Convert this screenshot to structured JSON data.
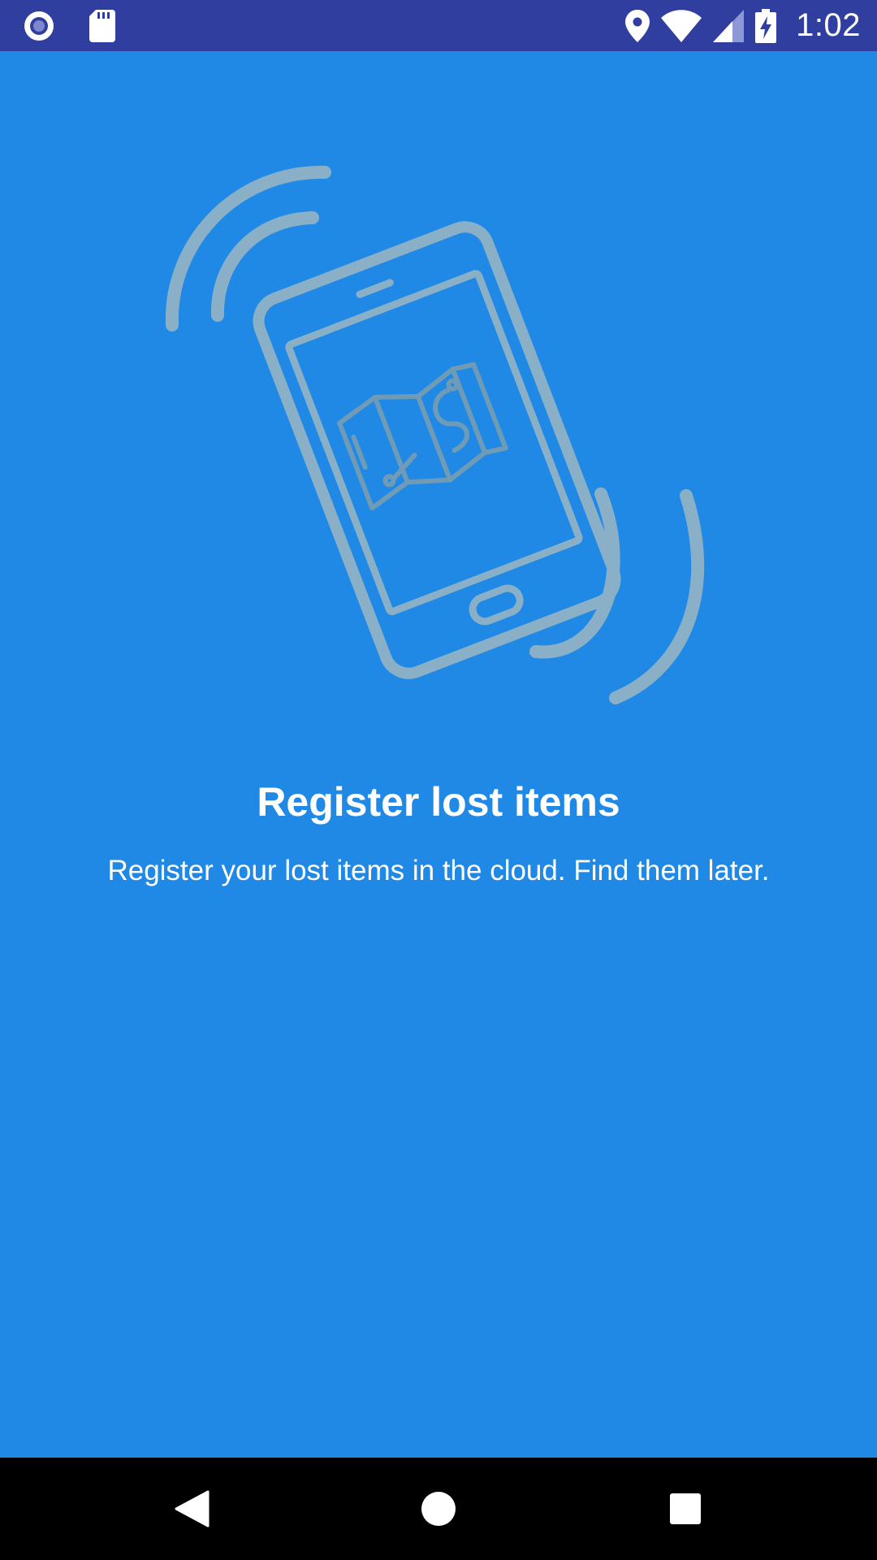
{
  "status_bar": {
    "time": "1:02",
    "left_icons": [
      "app-notification-icon",
      "sd-card-icon"
    ],
    "right_icons": [
      "location-icon",
      "wifi-icon",
      "cell-signal-icon",
      "battery-charging-icon"
    ],
    "background": "#303f9f"
  },
  "onboarding": {
    "illustration": "phone-vibrating-map-icon",
    "title": "Register lost items",
    "subtitle": "Register your lost items in the cloud. Find them later.",
    "background": "#1f89e5"
  },
  "nav_bar": {
    "buttons": [
      "back-button",
      "home-button",
      "recents-button"
    ]
  }
}
